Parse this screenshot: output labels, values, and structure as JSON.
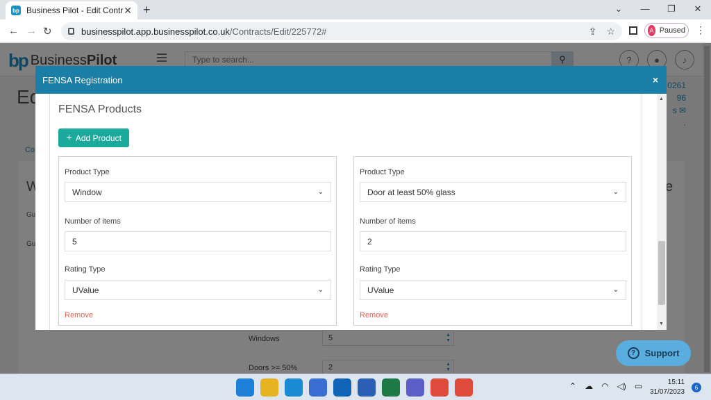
{
  "browser": {
    "tab_title": "Business Pilot - Edit Contract",
    "tab_icon": "bp",
    "new_tab": "+",
    "close_tab": "✕",
    "window_controls": {
      "min": "⌄",
      "max": "—",
      "restore": "❐",
      "close": "✕"
    },
    "url_host": "businesspilot.app.businesspilot.co.uk",
    "url_path": "/Contracts/Edit/225772#",
    "profile_initial": "A",
    "profile_status": "Paused"
  },
  "app": {
    "logo_mark": "bp",
    "logo_text_1": "Business",
    "logo_text_2": "Pilot",
    "search_placeholder": "Type to search...",
    "bg_title": "Ed",
    "bg_right_lines": [
      "0261",
      "96",
      "s ✉",
      "."
    ],
    "bg_link": "Co",
    "bg_w": "W",
    "bg_e": "e",
    "bg_gu1": "Gu",
    "bg_gu2": "Gu",
    "bg_rows": [
      {
        "label": "Windows",
        "value": "5"
      },
      {
        "label": "Doors >= 50%",
        "value": "2"
      }
    ]
  },
  "modal": {
    "title": "FENSA Registration",
    "close": "×",
    "section_title": "FENSA Products",
    "add_button": "Add Product",
    "products": [
      {
        "product_type_label": "Product Type",
        "product_type": "Window",
        "items_label": "Number of items",
        "items": "5",
        "rating_label": "Rating Type",
        "rating": "UValue",
        "remove": "Remove"
      },
      {
        "product_type_label": "Product Type",
        "product_type": "Door at least 50% glass",
        "items_label": "Number of items",
        "items": "2",
        "rating_label": "Rating Type",
        "rating": "UValue",
        "remove": "Remove"
      }
    ]
  },
  "support": {
    "label": "Support"
  },
  "taskbar": {
    "apps": [
      {
        "name": "windows-start-icon",
        "color": "#1d7fd8"
      },
      {
        "name": "file-explorer-icon",
        "color": "#e8b321"
      },
      {
        "name": "edge-icon",
        "color": "#1a8ad4"
      },
      {
        "name": "store-icon",
        "color": "#3a6fd1"
      },
      {
        "name": "outlook-icon",
        "color": "#0f64b8"
      },
      {
        "name": "word-icon",
        "color": "#2b5eb5"
      },
      {
        "name": "excel-icon",
        "color": "#1e7a45"
      },
      {
        "name": "teams-icon",
        "color": "#5b5fc7"
      },
      {
        "name": "chrome-icon",
        "color": "#e04a3b"
      },
      {
        "name": "chrome-profile-icon",
        "color": "#e04a3b"
      }
    ],
    "time": "15:11",
    "date": "31/07/2023",
    "notifications": "6"
  },
  "colors": {
    "modal_header": "#1a7ea6",
    "add_button": "#1aa99a",
    "remove_link": "#e8614e",
    "support": "#5aaedf"
  }
}
